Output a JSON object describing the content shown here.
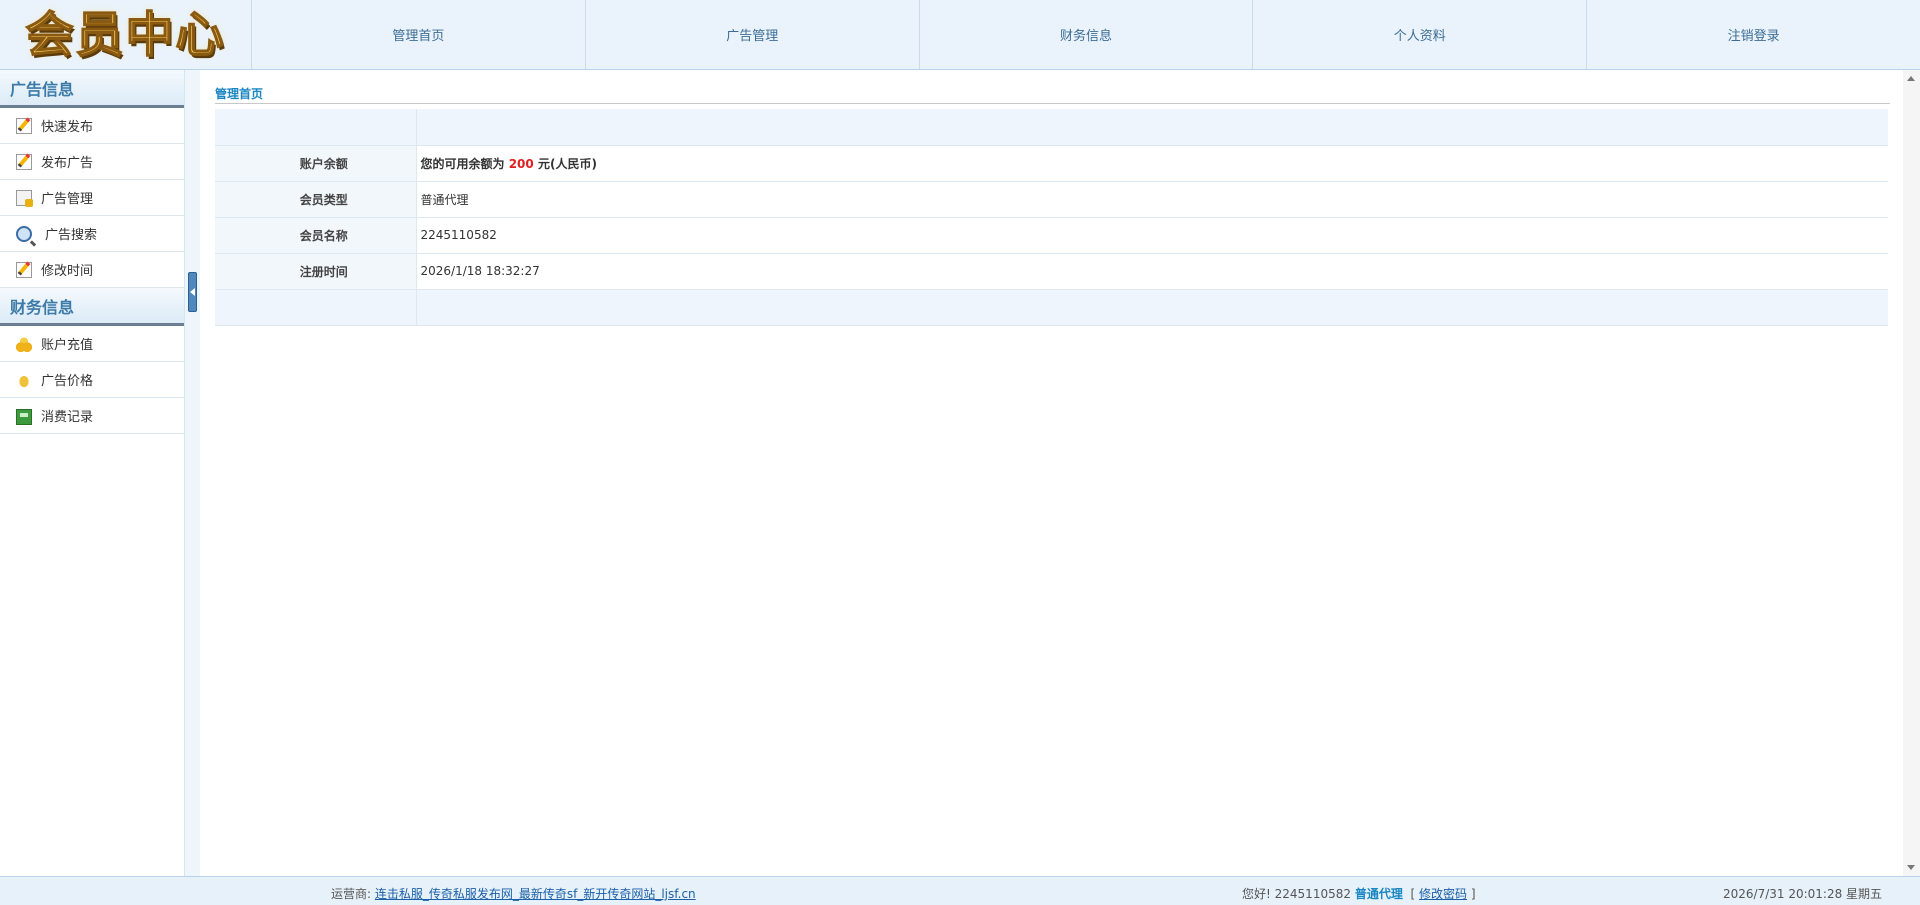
{
  "header": {
    "logo_text": "会员中心",
    "nav": [
      "管理首页",
      "广告管理",
      "财务信息",
      "个人资料",
      "注销登录"
    ]
  },
  "sidebar": {
    "sections": [
      {
        "title": "广告信息",
        "items": [
          "快速发布",
          "发布广告",
          "广告管理",
          "广告搜索",
          "修改时间"
        ]
      },
      {
        "title": "财务信息",
        "items": [
          "账户充值",
          "广告价格",
          "消费记录"
        ]
      }
    ]
  },
  "main": {
    "breadcrumb": "管理首页",
    "rows": {
      "balance": {
        "label": "账户余额",
        "prefix": "您的可用余额为",
        "amount": "200",
        "suffix": "元(人民币)"
      },
      "member_type": {
        "label": "会员类型",
        "value": "普通代理"
      },
      "member_name": {
        "label": "会员名称",
        "value": "2245110582"
      },
      "register_time": {
        "label": "注册时间",
        "value": "2026/1/18 18:32:27"
      }
    }
  },
  "footer": {
    "operator_label": "运营商:",
    "operator_link": "连击私服_传奇私服发布网_最新传奇sf_新开传奇网站_ljsf.cn",
    "greeting": "您好!",
    "username": "2245110582",
    "level": "普通代理",
    "bracket_open": "[",
    "change_password": "修改密码",
    "bracket_close": "]",
    "datetime": "2026/7/31 20:01:28 星期五"
  }
}
